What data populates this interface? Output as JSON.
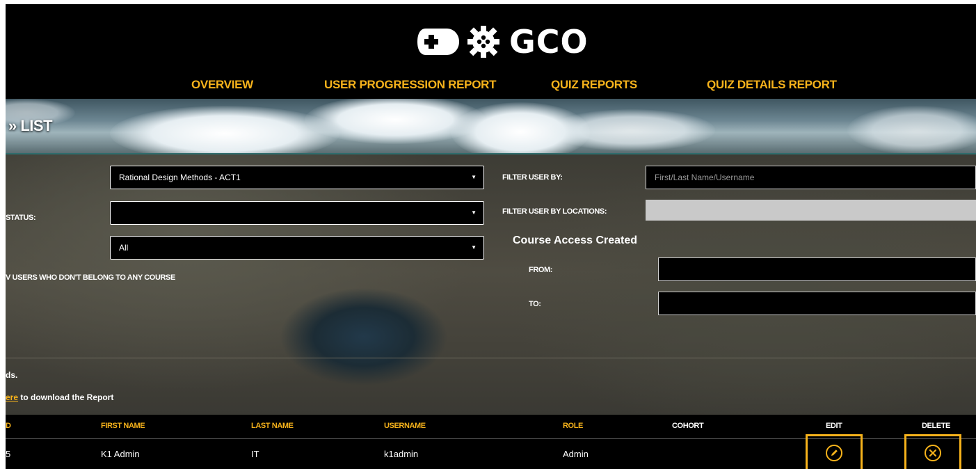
{
  "brand": {
    "logo_text": "GCO"
  },
  "nav": {
    "overview": "OVERVIEW",
    "user_progression": "USER PROGRESSION REPORT",
    "quiz_reports": "QUIZ REPORTS",
    "quiz_details": "QUIZ DETAILS REPORT"
  },
  "banner": {
    "breadcrumb": "» LIST"
  },
  "filters": {
    "course_select_value": "Rational Design Methods - ACT1",
    "status_label": "STATUS:",
    "status_select_value": "",
    "third_select_value": "All",
    "no_course_label": "V USERS WHO DON'T BELONG TO ANY COURSE",
    "filter_user_by_label": "FILTER USER BY:",
    "filter_user_placeholder": "First/Last Name/Username",
    "filter_locations_label": "FILTER USER BY LOCATIONS:",
    "course_access_heading": "Course Access Created",
    "from_label": "FROM:",
    "to_label": "TO:",
    "records_text": "ds.",
    "download_link": "ere",
    "download_text": " to download the Report"
  },
  "table": {
    "headers": {
      "id": "D",
      "first_name": "FIRST NAME",
      "last_name": "LAST NAME",
      "username": "USERNAME",
      "role": "ROLE",
      "cohort": "COHORT",
      "edit": "EDIT",
      "delete": "DELETE"
    },
    "rows": [
      {
        "id": "5",
        "first_name": "K1 Admin",
        "last_name": "IT",
        "username": "k1admin",
        "role": "Admin",
        "cohort": ""
      }
    ]
  },
  "colors": {
    "accent": "#f6b21b",
    "background": "#000000",
    "text": "#ffffff"
  },
  "icons": {
    "edit": "pencil-circle-icon",
    "delete": "x-circle-icon",
    "logo": "gamepad-gear-icon"
  }
}
